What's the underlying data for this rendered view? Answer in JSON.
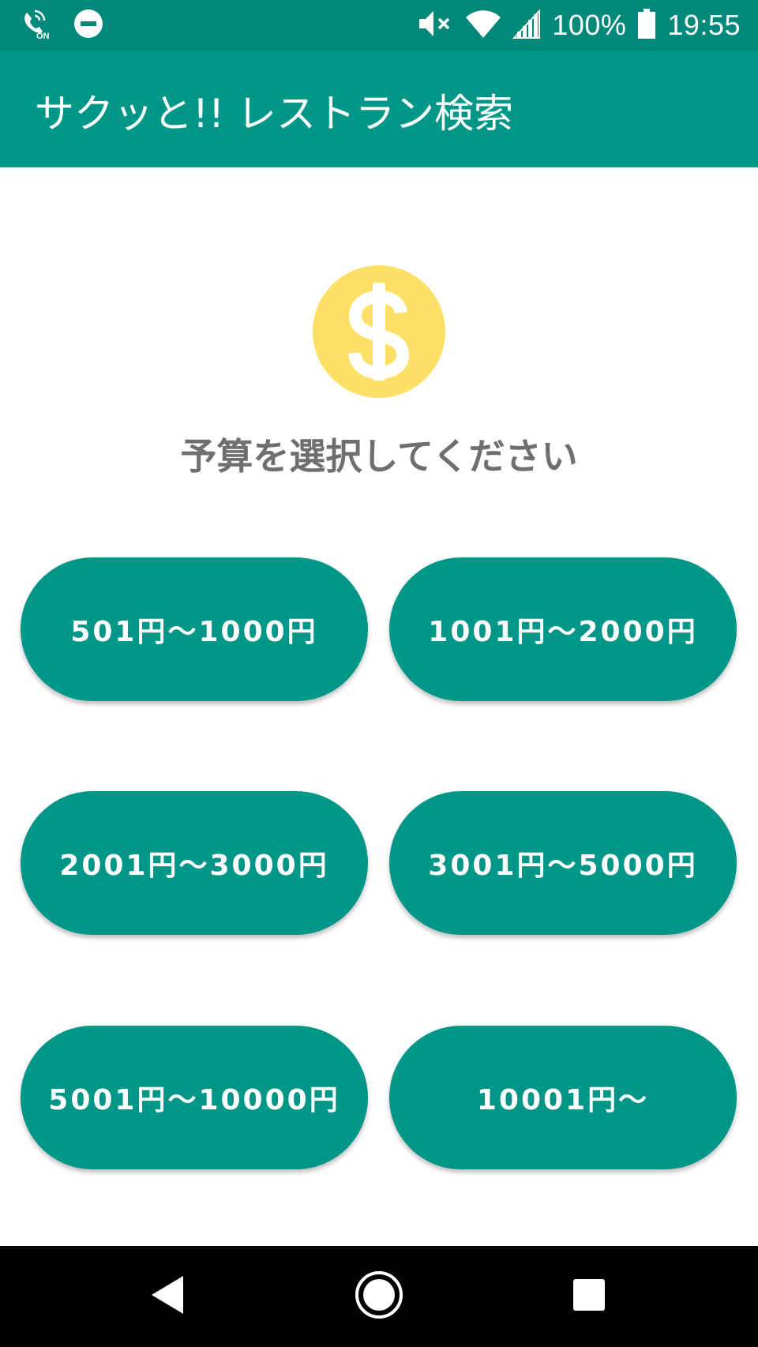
{
  "status_bar": {
    "battery_text": "100%",
    "time": "19:55",
    "icons": [
      "volte-on-icon",
      "do-not-disturb-icon",
      "mute-icon",
      "wifi-icon",
      "cell-signal-icon",
      "battery-icon"
    ]
  },
  "app_bar": {
    "title": "サクッと!! レストラン検索"
  },
  "main": {
    "icon": "dollar-coin-icon",
    "prompt": "予算を選択してください",
    "budget_options": [
      {
        "label": "501円〜1000円"
      },
      {
        "label": "1001円〜2000円"
      },
      {
        "label": "2001円〜3000円"
      },
      {
        "label": "3001円〜5000円"
      },
      {
        "label": "5001円〜10000円"
      },
      {
        "label": "10001円〜"
      }
    ]
  },
  "nav_bar": {
    "icons": [
      "back-icon",
      "home-icon",
      "recents-icon"
    ]
  },
  "colors": {
    "status_bar": "#00897b",
    "primary": "#009688",
    "coin": "#ffe066",
    "prompt_text": "#6f6f6f"
  }
}
